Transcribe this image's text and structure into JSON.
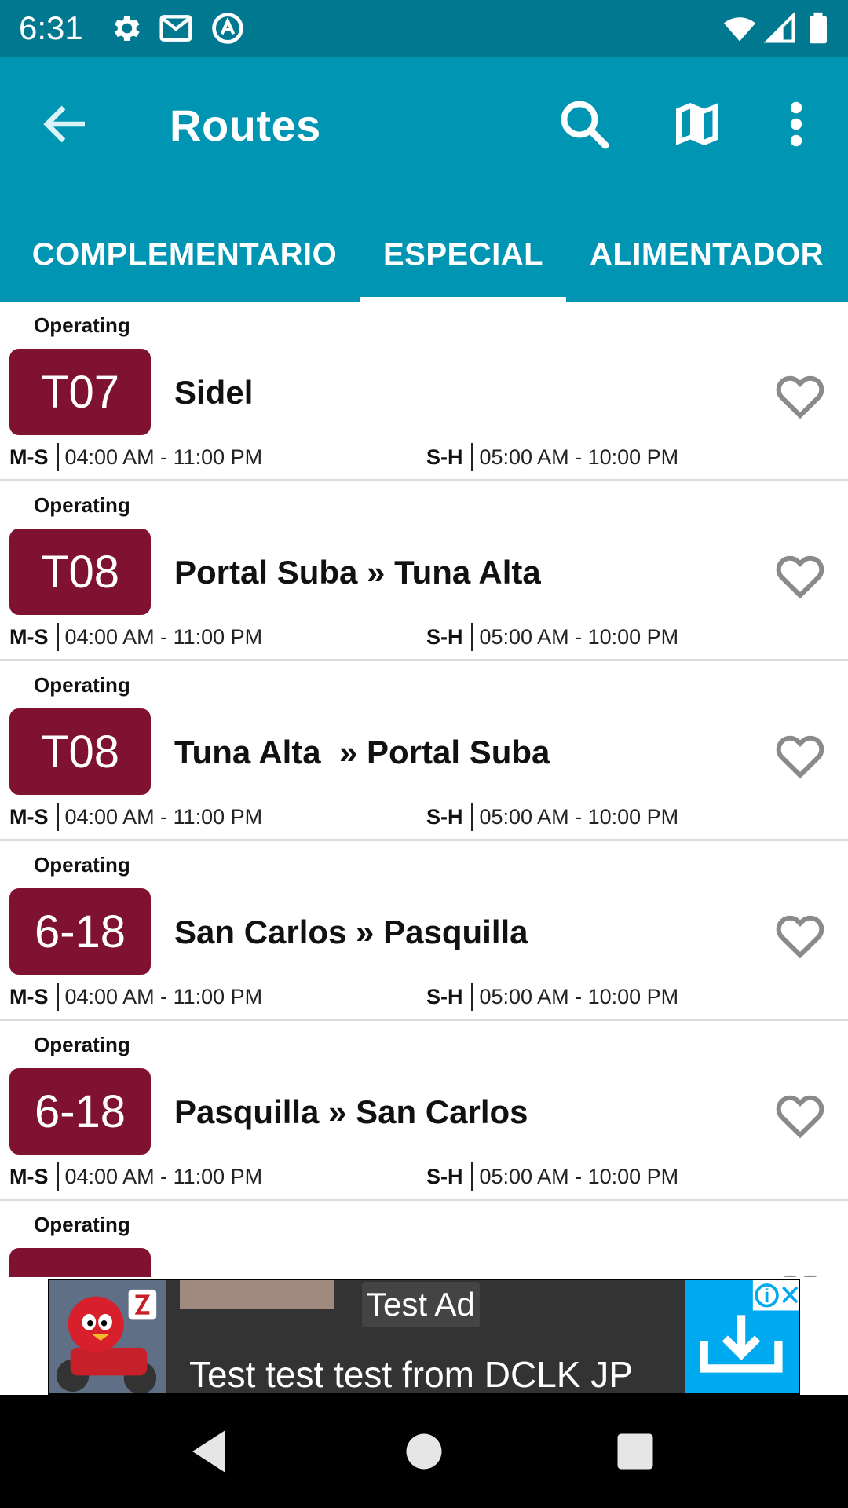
{
  "status_bar": {
    "time": "6:31",
    "icons": [
      "gear-icon",
      "gmail-icon",
      "circle-a-icon",
      "wifi-icon",
      "signal-icon",
      "battery-icon"
    ],
    "background": "#00788f"
  },
  "app_bar": {
    "title": "Routes",
    "background": "#0096b3",
    "icons": [
      "back-arrow-icon",
      "search-icon",
      "map-icon",
      "more-vert-icon"
    ]
  },
  "tabs": [
    {
      "label": "COMPLEMENTARIO",
      "selected": false
    },
    {
      "label": "ESPECIAL",
      "selected": true
    },
    {
      "label": "ALIMENTADOR",
      "selected": false
    }
  ],
  "routes": [
    {
      "status": "Operating",
      "code": "T07",
      "name": "Sidel",
      "weekday_label": "M-S",
      "weekday_hours": "04:00 AM - 11:00 PM",
      "holiday_label": "S-H",
      "holiday_hours": "05:00 AM - 10:00 PM"
    },
    {
      "status": "Operating",
      "code": "T08",
      "name": "Portal Suba » Tuna Alta",
      "weekday_label": "M-S",
      "weekday_hours": "04:00 AM - 11:00 PM",
      "holiday_label": "S-H",
      "holiday_hours": "05:00 AM - 10:00 PM"
    },
    {
      "status": "Operating",
      "code": "T08",
      "name": "Tuna Alta  » Portal Suba",
      "weekday_label": "M-S",
      "weekday_hours": "04:00 AM - 11:00 PM",
      "holiday_label": "S-H",
      "holiday_hours": "05:00 AM - 10:00 PM"
    },
    {
      "status": "Operating",
      "code": "6-18",
      "name": "San Carlos » Pasquilla",
      "weekday_label": "M-S",
      "weekday_hours": "04:00 AM - 11:00 PM",
      "holiday_label": "S-H",
      "holiday_hours": "05:00 AM - 10:00 PM"
    },
    {
      "status": "Operating",
      "code": "6-18",
      "name": "Pasquilla » San Carlos",
      "weekday_label": "M-S",
      "weekday_hours": "04:00 AM - 11:00 PM",
      "holiday_label": "S-H",
      "holiday_hours": "05:00 AM - 10:00 PM"
    },
    {
      "status": "Operating",
      "code": "",
      "name": "",
      "weekday_label": "",
      "weekday_hours": "",
      "holiday_label": "",
      "holiday_hours": ""
    }
  ],
  "colors": {
    "badge": "#7f1230",
    "favorite_outline": "#8a8a8a",
    "divider": "#dcdcdc"
  },
  "ad": {
    "label": "Test Ad",
    "text": "Test test test from DCLK JP",
    "icons": [
      "game-thumbnail-icon",
      "info-icon",
      "close-icon",
      "download-icon"
    ]
  },
  "nav_bar": {
    "icons": [
      "back-triangle-icon",
      "home-circle-icon",
      "recents-square-icon"
    ]
  }
}
